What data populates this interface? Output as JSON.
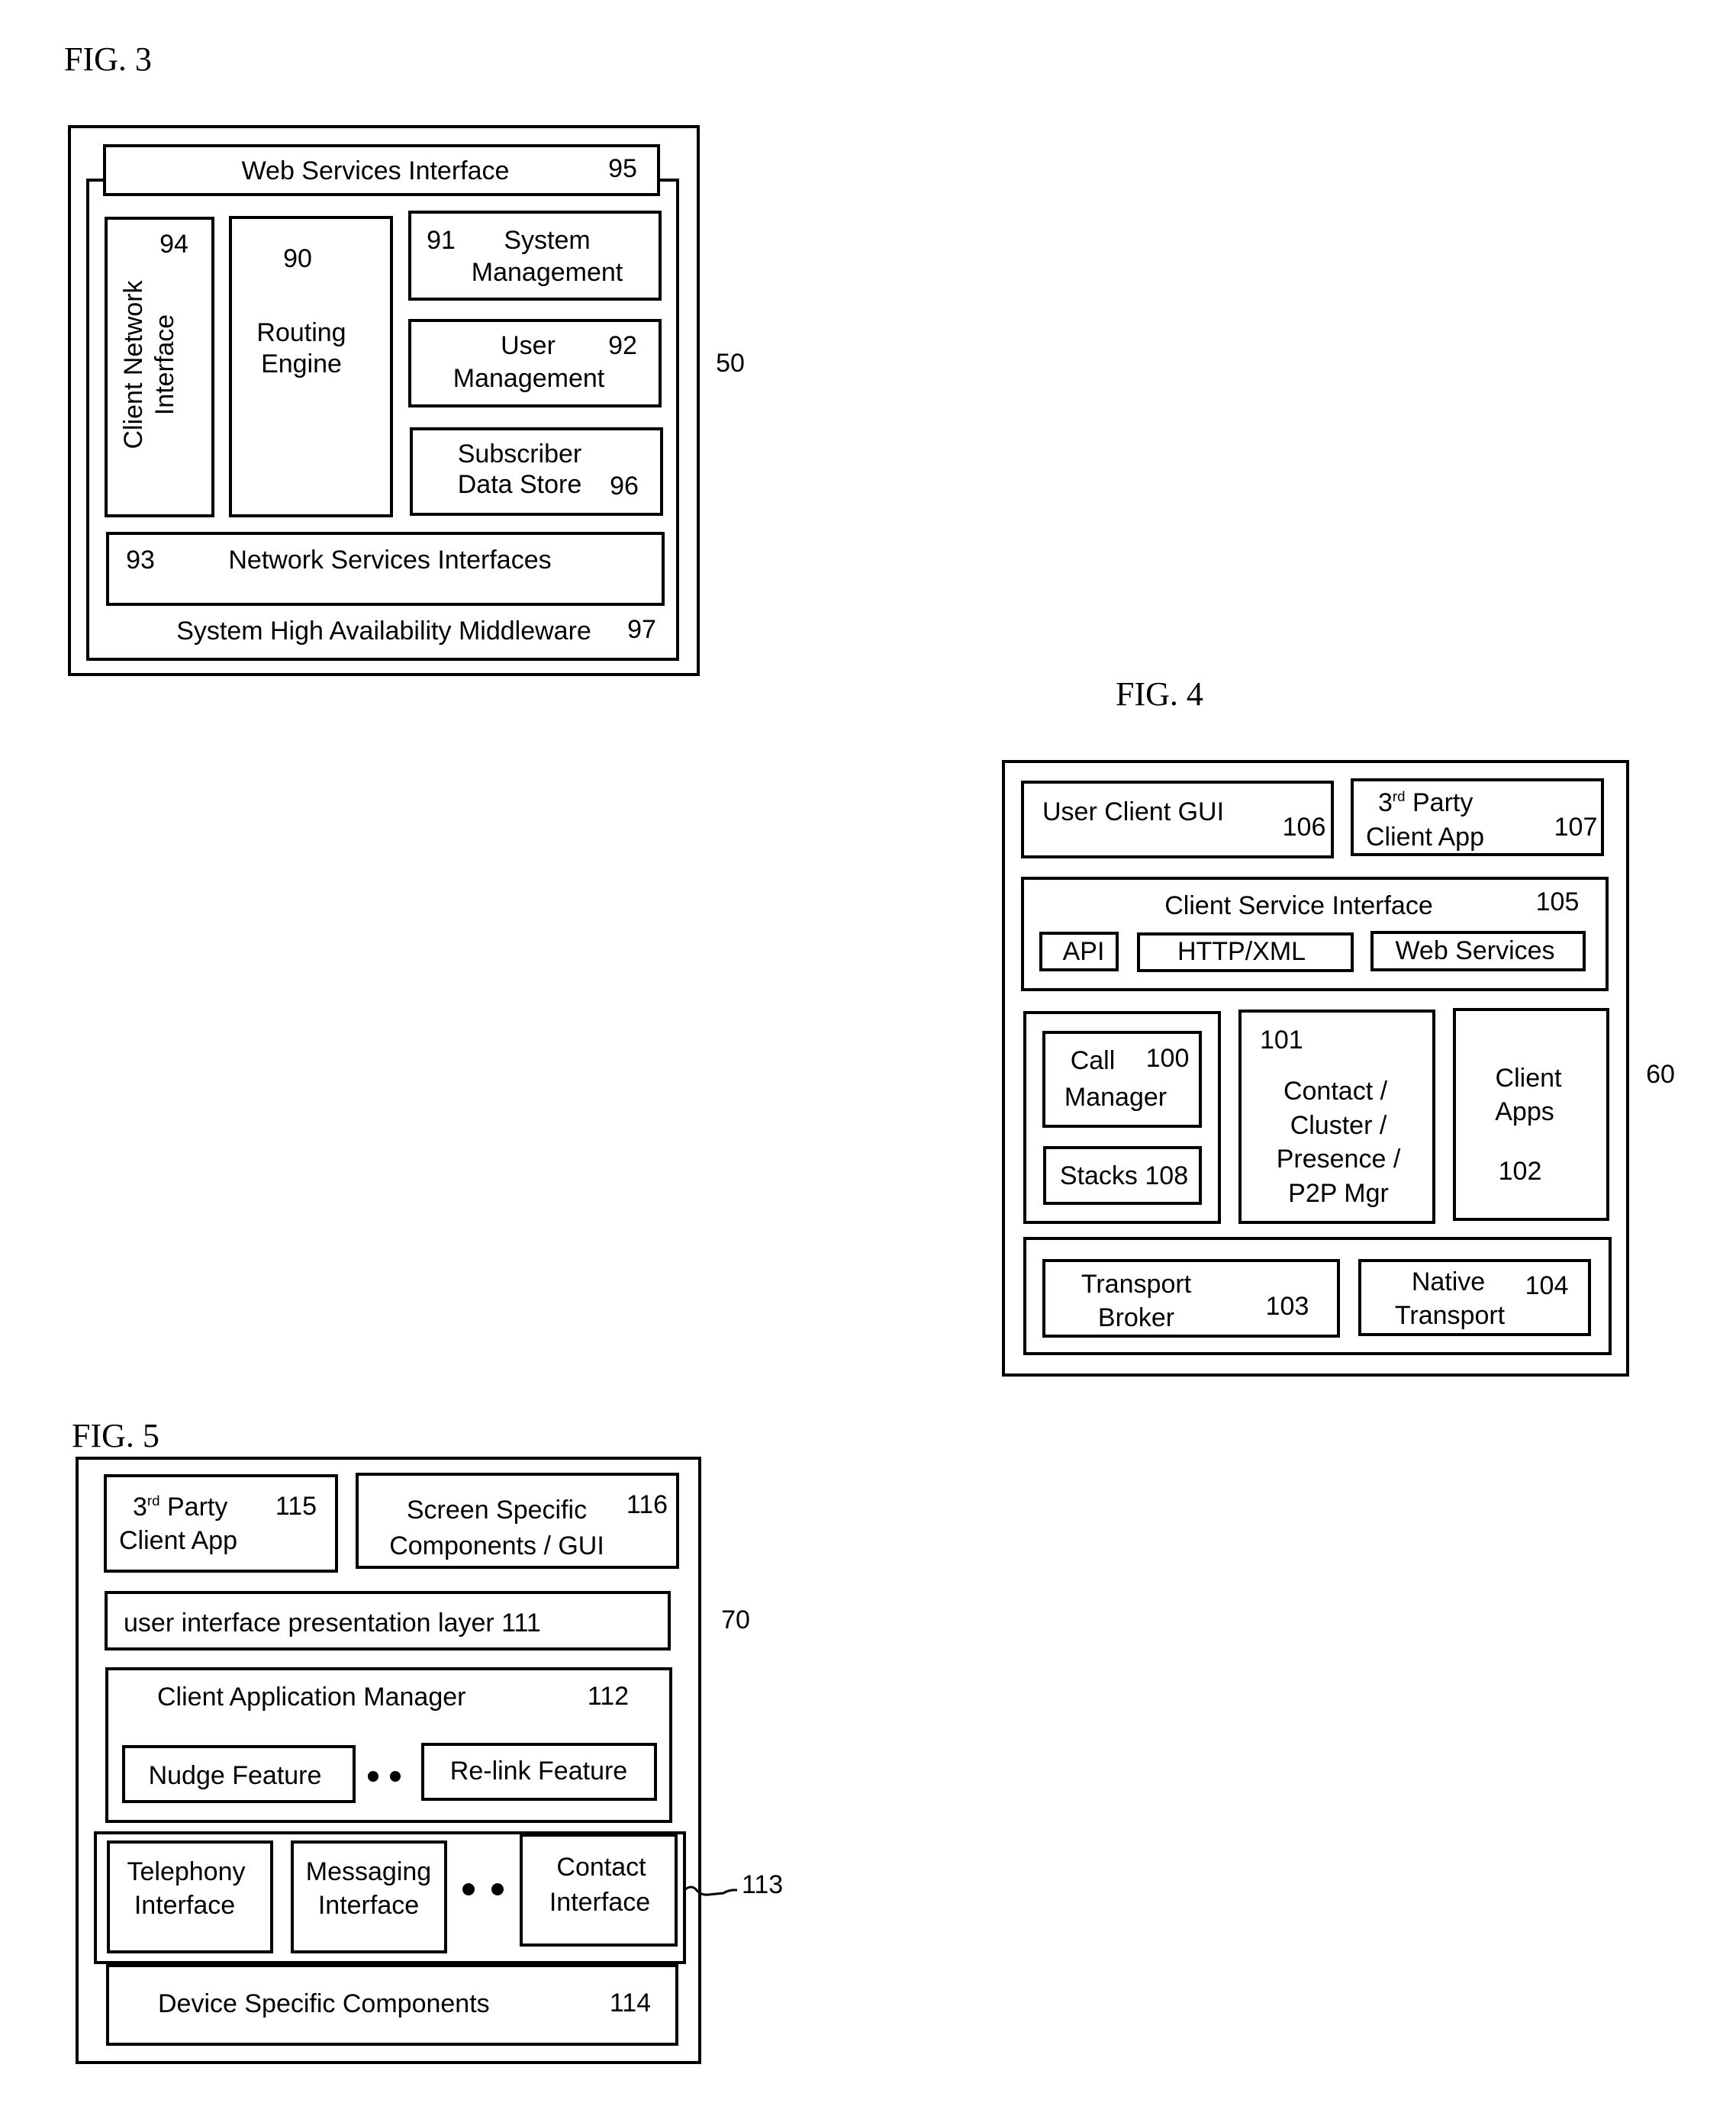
{
  "fig3": {
    "title": "FIG. 3",
    "ref": "50",
    "web_services": {
      "label": "Web Services Interface",
      "ref": "95"
    },
    "client_network": {
      "line1": "Client Network",
      "line2": "Interface",
      "ref": "94"
    },
    "routing": {
      "line1": "Routing",
      "line2": "Engine",
      "ref": "90"
    },
    "system_mgmt": {
      "line1": "System",
      "line2": "Management",
      "ref": "91"
    },
    "user_mgmt": {
      "line1": "User",
      "line2": "Management",
      "ref": "92"
    },
    "subscriber": {
      "line1": "Subscriber",
      "line2": "Data Store",
      "ref": "96"
    },
    "network_services": {
      "label": "Network Services Interfaces",
      "ref": "93"
    },
    "middleware": {
      "label": "System High Availability Middleware",
      "ref": "97"
    }
  },
  "fig4": {
    "title": "FIG. 4",
    "ref": "60",
    "user_client_gui": {
      "label": "User Client GUI",
      "ref": "106"
    },
    "third_party": {
      "num": "3",
      "sup": "rd",
      "line1_rest": " Party",
      "line2": "Client App",
      "ref": "107"
    },
    "client_service_interface": {
      "label": "Client Service Interface",
      "ref": "105",
      "items": [
        "API",
        "HTTP/XML",
        "Web Services"
      ]
    },
    "call_manager": {
      "line1": "Call",
      "line2": "Manager",
      "ref": "100"
    },
    "stacks": {
      "label": "Stacks 108"
    },
    "contact_mgr": {
      "ref": "101",
      "lines": [
        "Contact /",
        "Cluster /",
        "Presence /",
        "P2P Mgr"
      ]
    },
    "client_apps": {
      "line1": "Client",
      "line2": "Apps",
      "ref": "102"
    },
    "transport_broker": {
      "line1": "Transport",
      "line2": "Broker",
      "ref": "103"
    },
    "native_transport": {
      "line1": "Native",
      "line2": "Transport",
      "ref": "104"
    }
  },
  "fig5": {
    "title": "FIG. 5",
    "ref": "70",
    "third_party": {
      "num": "3",
      "sup": "rd",
      "line1_rest": " Party",
      "line2": "Client App",
      "ref": "115"
    },
    "screen_specific": {
      "line1": "Screen Specific",
      "line2": "Components / GUI",
      "ref": "116"
    },
    "ui_presentation": {
      "label": "user interface presentation layer 111"
    },
    "client_app_manager": {
      "label": "Client Application Manager",
      "ref": "112",
      "features": [
        "Nudge Feature",
        "Re-link Feature"
      ]
    },
    "interfaces": {
      "ref": "113",
      "items": [
        {
          "line1": "Telephony",
          "line2": "Interface"
        },
        {
          "line1": "Messaging",
          "line2": "Interface"
        },
        {
          "line1": "Contact",
          "line2": "Interface"
        }
      ]
    },
    "device_specific": {
      "label": "Device Specific Components",
      "ref": "114"
    }
  }
}
